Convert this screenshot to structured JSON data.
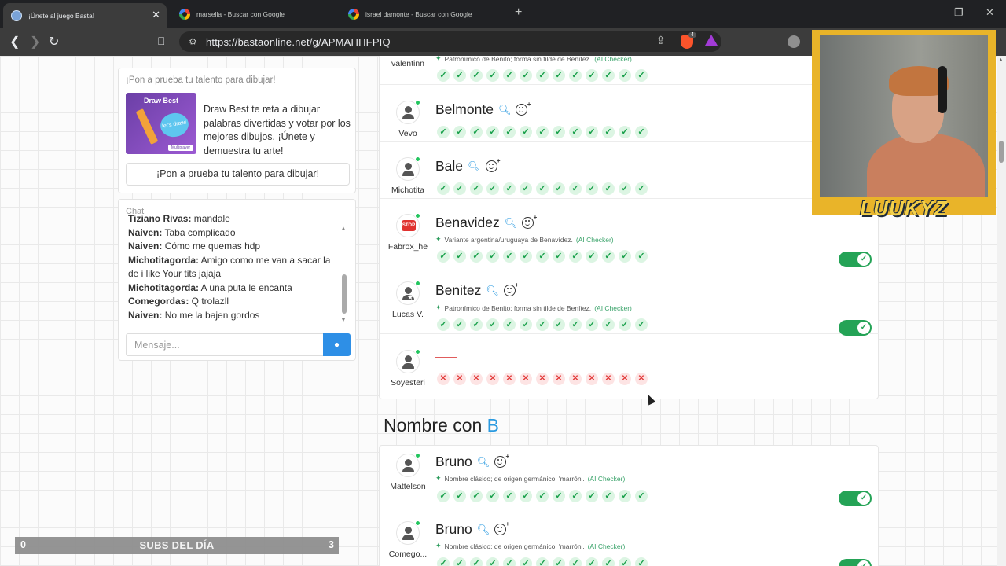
{
  "browser": {
    "tabs": [
      {
        "title": "¡Únete al juego Basta!",
        "active": true
      },
      {
        "title": "marsella - Buscar con Google",
        "active": false
      },
      {
        "title": "israel damonte - Buscar con Google",
        "active": false
      }
    ],
    "url": "https://bastaonline.net/g/APMAHHFPIQ",
    "shields_badge": "4"
  },
  "promo": {
    "heading": "¡Pon a prueba tu talento para dibujar!",
    "thumb_title": "Draw Best",
    "thumb_bubble": "let's draw!",
    "thumb_badge": "Multiplayer",
    "text": "Draw Best te reta a dibujar palabras divertidas y votar por los mejores dibujos. ¡Únete y demuestra tu arte!",
    "button_label": "¡Pon a prueba tu talento para dibujar!"
  },
  "chat": {
    "heading": "Chat",
    "messages": [
      {
        "user": "Tiziano Rivas:",
        "text": " mandale"
      },
      {
        "user": "Naiven:",
        "text": " Taba complicado"
      },
      {
        "user": "Naiven:",
        "text": " Cómo me quemas hdp"
      },
      {
        "user": "Michotitagorda:",
        "text": " Amigo como me van a sacar la de i like Your tits jajaja"
      },
      {
        "user": "Michotitagorda:",
        "text": " A una puta le encanta"
      },
      {
        "user": "Comegordas:",
        "text": " Q trolazll"
      },
      {
        "user": "Naiven:",
        "text": " No me la bajen gordos"
      }
    ],
    "input_placeholder": "Mensaje..."
  },
  "subs": {
    "left": "0",
    "label": "SUBS DEL DÍA",
    "right": "3"
  },
  "apellido_answers": [
    {
      "player": "valentinn",
      "word": "",
      "note": "Patronímico de Benito; forma sin tilde de Benítez.",
      "ai": "(AI Checker)",
      "votes": "ok",
      "toggle": false
    },
    {
      "player": "Vevo",
      "word": "Belmonte",
      "note": "",
      "ai": "",
      "votes": "ok",
      "toggle": false
    },
    {
      "player": "Michotita",
      "word": "Bale",
      "note": "",
      "ai": "",
      "votes": "ok",
      "toggle": false
    },
    {
      "player": "Fabrox_he",
      "word": "Benavidez",
      "note": "Variante argentina/uruguaya de Benavídez.",
      "ai": "(AI Checker)",
      "votes": "ok",
      "toggle": true
    },
    {
      "player": "Lucas V.",
      "word": "Benitez",
      "note": "Patronímico de Benito; forma sin tilde de Benítez.",
      "ai": "(AI Checker)",
      "votes": "ok",
      "toggle": true
    },
    {
      "player": "Soyesteri",
      "word": "",
      "note": "",
      "ai": "",
      "votes": "no",
      "toggle": false
    }
  ],
  "section": {
    "prefix": "Nombre con ",
    "letter": "B"
  },
  "nombre_answers": [
    {
      "player": "Mattelson",
      "word": "Bruno",
      "note": "Nombre clásico; de origen germánico, 'marrón'.",
      "ai": "(AI Checker)",
      "votes": "ok",
      "toggle": true
    },
    {
      "player": "Comego...",
      "word": "Bruno",
      "note": "Nombre clásico; de origen germánico, 'marrón'.",
      "ai": "(AI Checker)",
      "votes": "ok",
      "toggle": true
    }
  ],
  "webcam": {
    "name": "LUUKYZ"
  },
  "colors": {
    "accent": "#2a9ae0",
    "success": "#24a356",
    "danger": "#e23b3b",
    "webcam_frame": "#e9b429"
  }
}
